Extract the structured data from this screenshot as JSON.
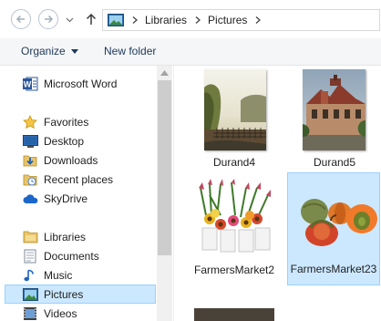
{
  "address": {
    "crumbs": [
      "Libraries",
      "Pictures"
    ]
  },
  "toolbar": {
    "organize_label": "Organize",
    "new_folder_label": "New folder"
  },
  "nav": {
    "items": [
      {
        "label": "Microsoft Word",
        "icon": "word-icon"
      },
      {
        "label": "Favorites",
        "icon": "star-icon"
      },
      {
        "label": "Desktop",
        "icon": "desktop-icon"
      },
      {
        "label": "Downloads",
        "icon": "downloads-icon"
      },
      {
        "label": "Recent places",
        "icon": "recent-places-icon"
      },
      {
        "label": "SkyDrive",
        "icon": "skydrive-icon"
      },
      {
        "label": "Libraries",
        "icon": "libraries-icon"
      },
      {
        "label": "Documents",
        "icon": "documents-icon"
      },
      {
        "label": "Music",
        "icon": "music-icon"
      },
      {
        "label": "Pictures",
        "icon": "pictures-icon",
        "selected": true
      },
      {
        "label": "Videos",
        "icon": "videos-icon"
      }
    ]
  },
  "files": [
    {
      "name": "Durand4"
    },
    {
      "name": "Durand5"
    },
    {
      "name": "FarmersMarket2"
    },
    {
      "name": "FarmersMarket23",
      "selected": true
    }
  ],
  "colors": {
    "selection_fill": "#cce8ff",
    "selection_border": "#99d1ff",
    "toolbar_text": "#1e395b"
  }
}
